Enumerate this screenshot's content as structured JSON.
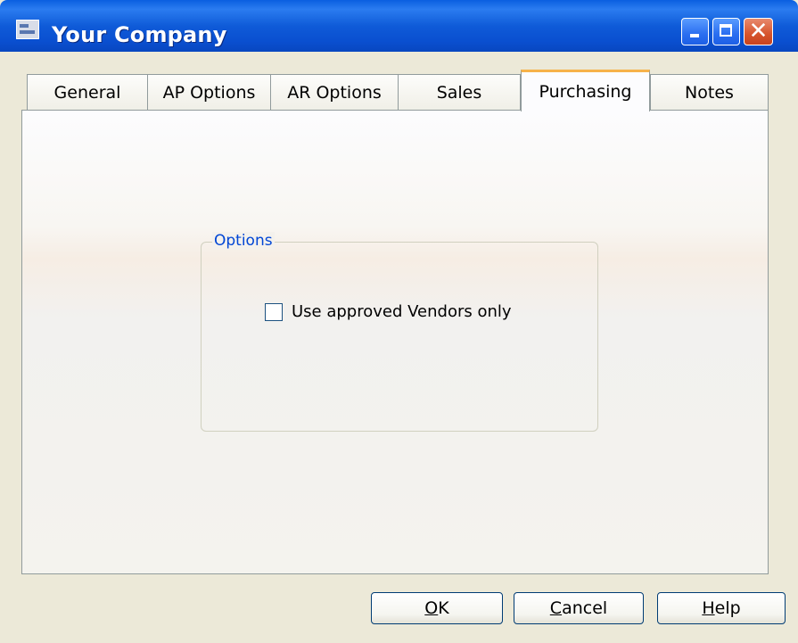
{
  "window": {
    "title": "Your Company"
  },
  "title_icon": "app-window-icon",
  "controls": {
    "minimize_icon": "minimize-icon",
    "maximize_icon": "maximize-icon",
    "close_icon": "close-icon",
    "close_glyph": "✕"
  },
  "tabs": [
    {
      "label": "General"
    },
    {
      "label": "AP Options"
    },
    {
      "label": "AR Options"
    },
    {
      "label": "Sales"
    },
    {
      "label": "Purchasing",
      "active": true
    },
    {
      "label": "Notes"
    }
  ],
  "options_group": {
    "label": "Options",
    "checkbox_label": "Use approved Vendors only",
    "checked": false
  },
  "buttons": {
    "ok": {
      "mnemonic": "O",
      "rest": "K"
    },
    "cancel": {
      "mnemonic": "C",
      "rest": "ancel"
    },
    "help": {
      "mnemonic": "H",
      "rest": "elp"
    }
  },
  "colors": {
    "titlebar": "#0a5fe0",
    "tab_highlight": "#f6b24a",
    "group_label": "#0046d5"
  }
}
